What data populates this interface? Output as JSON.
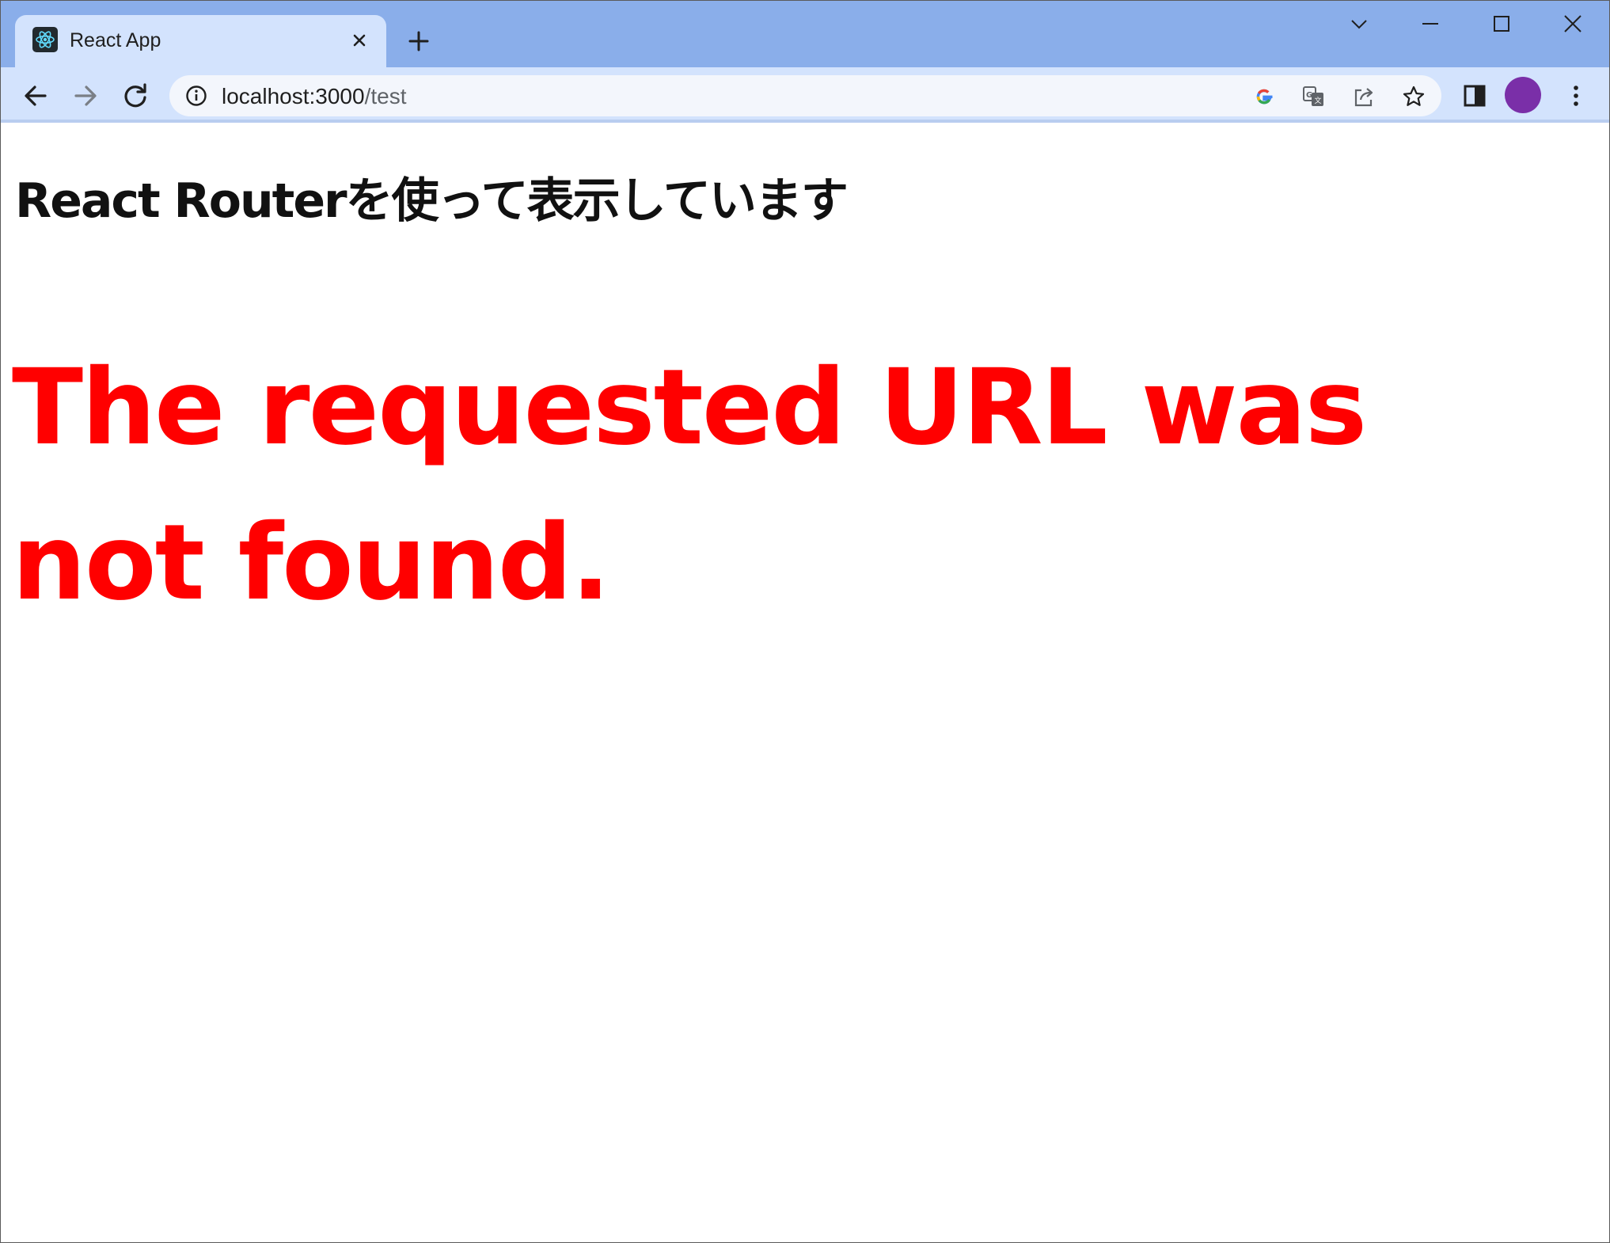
{
  "browser": {
    "tab": {
      "title": "React App",
      "favicon": "react-logo-icon"
    },
    "new_tab_icon": "plus-icon",
    "window_controls": [
      "tab-search-icon",
      "minimize-icon",
      "maximize-icon",
      "close-icon"
    ],
    "address_bar": {
      "host": "localhost:3000",
      "path": "/test",
      "site_info_icon": "info-icon"
    },
    "omnibox_icons": [
      "google-lens-icon",
      "translate-icon",
      "share-icon",
      "bookmark-star-icon"
    ],
    "toolbar_icons": [
      "side-panel-icon",
      "profile-avatar",
      "more-menu-icon"
    ],
    "colors": {
      "tabstrip": "#8aaeea",
      "active_tab": "#d3e3fd",
      "omnibox": "#f3f6fc",
      "avatar": "#7a2fa8"
    }
  },
  "page": {
    "heading": "React Routerを使って表示しています",
    "error_message": "The requested URL was not found.",
    "colors": {
      "heading": "#111111",
      "error_message": "#ff0000"
    }
  }
}
